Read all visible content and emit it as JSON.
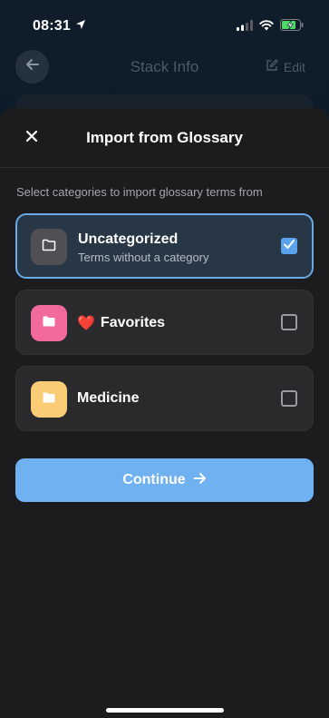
{
  "status_bar": {
    "time": "08:31",
    "location_icon": "location-arrow-icon",
    "signal_icon": "cellular-signal-icon",
    "wifi_icon": "wifi-icon",
    "battery_icon": "battery-charging-icon"
  },
  "background_page": {
    "title": "Stack Info",
    "edit_label": "Edit",
    "back_icon": "arrow-left-icon",
    "edit_icon": "edit-icon"
  },
  "sheet": {
    "title": "Import from Glossary",
    "close_icon": "close-icon",
    "instructions": "Select categories to import glossary terms from",
    "categories": [
      {
        "name": "Uncategorized",
        "description": "Terms without a category",
        "emoji": "",
        "selected": true,
        "icon_color": "#505054",
        "icon": "folder-outline-icon"
      },
      {
        "name": "Favorites",
        "description": "",
        "emoji": "❤️",
        "selected": false,
        "icon_color": "#f2699d",
        "icon": "folder-icon"
      },
      {
        "name": "Medicine",
        "description": "",
        "emoji": "",
        "selected": false,
        "icon_color": "#f9cc75",
        "icon": "folder-icon"
      }
    ],
    "continue_label": "Continue",
    "continue_icon": "arrow-right-icon"
  },
  "colors": {
    "accent": "#6fb1f1",
    "checkbox_checked": "#5aa2ec",
    "selected_border": "#6aa8e6",
    "sheet_background": "#1c1c1e"
  }
}
